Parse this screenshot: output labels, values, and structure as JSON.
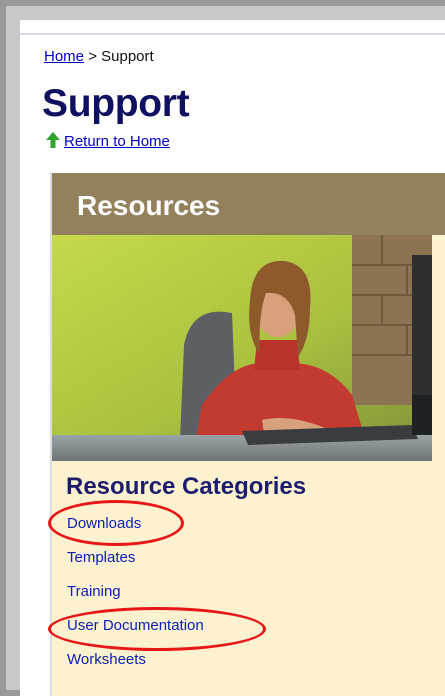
{
  "breadcrumb": {
    "home_label": "Home",
    "separator": ">",
    "current": "Support"
  },
  "page": {
    "title": "Support",
    "return_link": "Return to Home"
  },
  "resources": {
    "title": "Resources",
    "categories_heading": "Resource Categories",
    "categories": [
      {
        "label": "Downloads",
        "highlighted": true
      },
      {
        "label": "Templates",
        "highlighted": false
      },
      {
        "label": "Training",
        "highlighted": false
      },
      {
        "label": "User Documentation",
        "highlighted": true
      },
      {
        "label": "Worksheets",
        "highlighted": false
      }
    ]
  },
  "colors": {
    "title": "#101060",
    "link": "#0000cc",
    "panel_header": "#93805c",
    "panel_background": "#fdf2d0",
    "highlight_ellipse": "#e81616",
    "return_arrow": "#2fa52f"
  },
  "icons": {
    "return": "up-arrow-icon"
  }
}
